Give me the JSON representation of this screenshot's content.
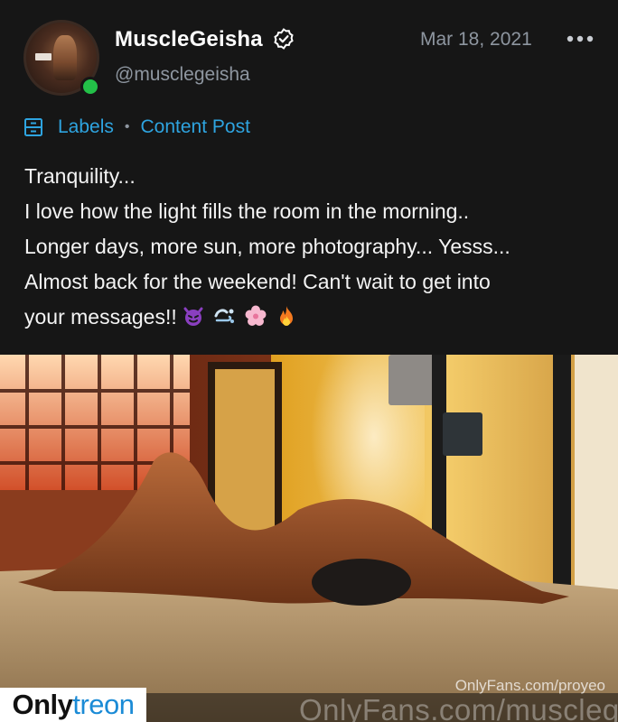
{
  "post": {
    "author": {
      "display_name": "MuscleGeisha",
      "handle": "@musclegeisha",
      "verified": true,
      "online": true,
      "avatar_icon": "profile-avatar"
    },
    "date": "Mar 18, 2021",
    "more_icon": "more-horizontal-icon",
    "labels": {
      "icon": "labels-icon",
      "label": "Labels",
      "separator": "•",
      "type": "Content Post"
    },
    "caption": {
      "lines": [
        "Tranquility...",
        "I love how the light fills the room in the morning..",
        "Longer days, more sun, more photography... Yesss...",
        "Almost back for the weekend! Can't wait to get into",
        "your messages!!"
      ],
      "emojis": [
        "devil-emoji",
        "wind-emoji",
        "blossom-emoji",
        "fire-emoji"
      ]
    },
    "media": {
      "watermark_small": "OnlyFans.com/proyeo",
      "watermark_large": "OnlyFans.com/musclegeisha"
    }
  },
  "site_badge": {
    "part1": "Only",
    "part2": "treon"
  },
  "colors": {
    "background": "#161616",
    "accent": "#2ea4e0",
    "muted": "#8e96a0",
    "online": "#23c048",
    "badge_blue": "#1b8bd6"
  }
}
